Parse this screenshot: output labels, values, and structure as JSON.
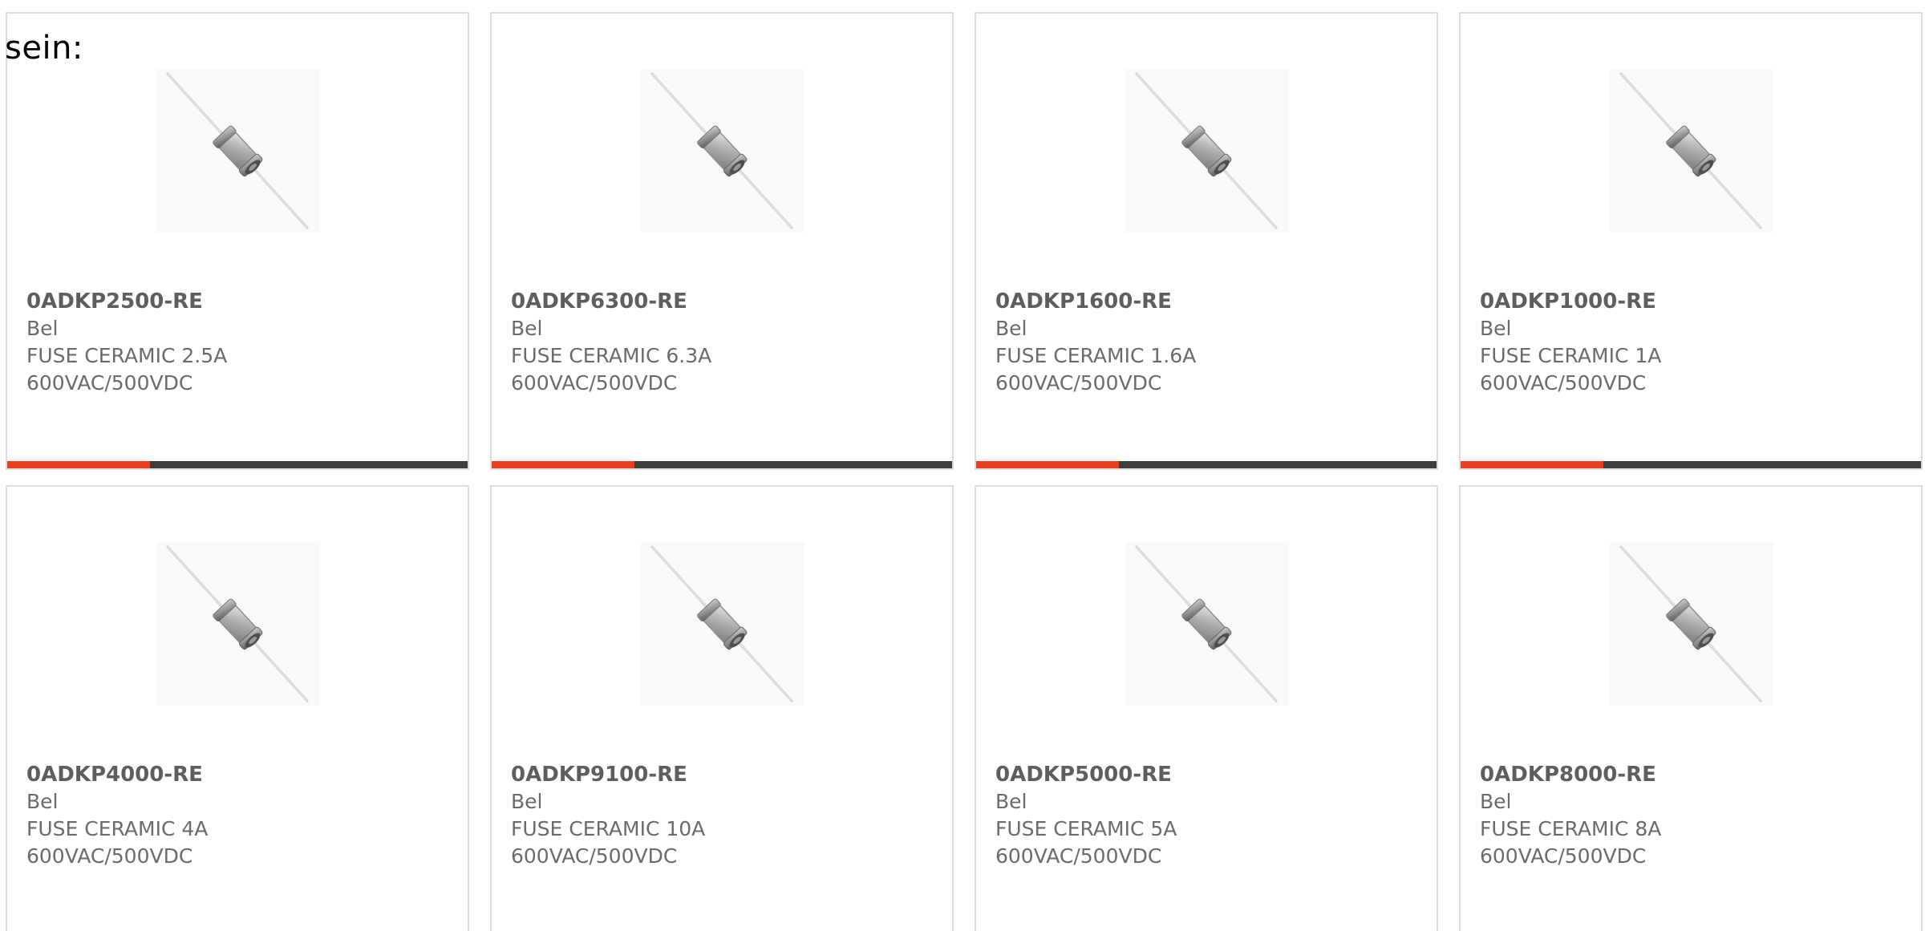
{
  "intro_text": "sein:",
  "colors": {
    "accent": "#e8401c",
    "bar": "#3d3d3d",
    "border": "#dcdcdc",
    "text": "#6a6a6a"
  },
  "products": [
    {
      "part": "0ADKP2500-RE",
      "brand": "Bel",
      "desc1": "FUSE CERAMIC 2.5A",
      "desc2": "600VAC/500VDC",
      "image": "axial-fuse-image",
      "progress": 0.31
    },
    {
      "part": "0ADKP6300-RE",
      "brand": "Bel",
      "desc1": "FUSE CERAMIC 6.3A",
      "desc2": "600VAC/500VDC",
      "image": "axial-fuse-image",
      "progress": 0.31
    },
    {
      "part": "0ADKP1600-RE",
      "brand": "Bel",
      "desc1": "FUSE CERAMIC 1.6A",
      "desc2": "600VAC/500VDC",
      "image": "axial-fuse-image",
      "progress": 0.31
    },
    {
      "part": "0ADKP1000-RE",
      "brand": "Bel",
      "desc1": "FUSE CERAMIC 1A",
      "desc2": "600VAC/500VDC",
      "image": "axial-fuse-image",
      "progress": 0.31
    },
    {
      "part": "0ADKP4000-RE",
      "brand": "Bel",
      "desc1": "FUSE CERAMIC 4A",
      "desc2": "600VAC/500VDC",
      "image": "axial-fuse-image"
    },
    {
      "part": "0ADKP9100-RE",
      "brand": "Bel",
      "desc1": "FUSE CERAMIC 10A",
      "desc2": "600VAC/500VDC",
      "image": "axial-fuse-image"
    },
    {
      "part": "0ADKP5000-RE",
      "brand": "Bel",
      "desc1": "FUSE CERAMIC 5A",
      "desc2": "600VAC/500VDC",
      "image": "axial-fuse-image"
    },
    {
      "part": "0ADKP8000-RE",
      "brand": "Bel",
      "desc1": "FUSE CERAMIC 8A",
      "desc2": "600VAC/500VDC",
      "image": "axial-fuse-image"
    }
  ]
}
